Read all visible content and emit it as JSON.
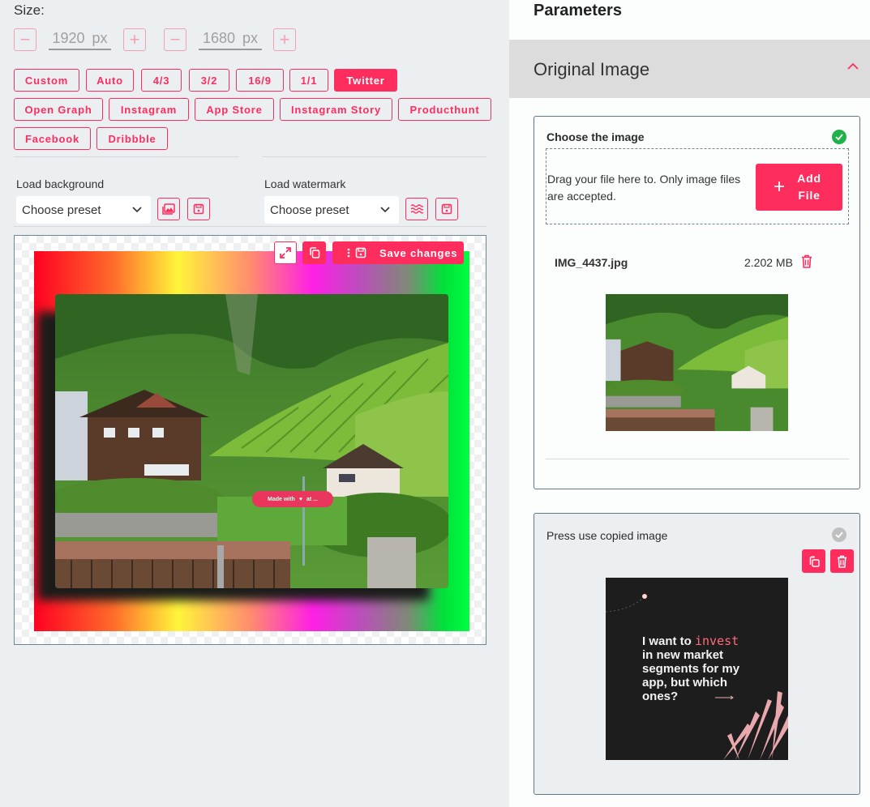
{
  "editor": {
    "size_label": "Size:",
    "width": {
      "value": "1920",
      "unit": "px",
      "decrement": "−",
      "increment": "+"
    },
    "height": {
      "value": "1680",
      "unit": "px",
      "decrement": "−",
      "increment": "+"
    },
    "presets": [
      {
        "label": "Custom",
        "active": false
      },
      {
        "label": "Auto",
        "active": false
      },
      {
        "label": "4/3",
        "active": false
      },
      {
        "label": "3/2",
        "active": false
      },
      {
        "label": "16/9",
        "active": false
      },
      {
        "label": "1/1",
        "active": false
      },
      {
        "label": "Twitter",
        "active": true
      },
      {
        "label": "Open Graph",
        "active": false
      },
      {
        "label": "Instagram",
        "active": false
      },
      {
        "label": "App Store",
        "active": false
      },
      {
        "label": "Instagram Story",
        "active": false
      },
      {
        "label": "Producthunt",
        "active": false
      },
      {
        "label": "Facebook",
        "active": false
      },
      {
        "label": "Dribbble",
        "active": false
      }
    ],
    "background": {
      "label": "Load background",
      "selected": "Choose preset",
      "icons": [
        "image-icon",
        "save-icon"
      ]
    },
    "watermark": {
      "label": "Load watermark",
      "selected": "Choose preset",
      "icons": [
        "waves-icon",
        "save-icon"
      ]
    },
    "canvas": {
      "toolbar": {
        "save_label": "Save changes"
      },
      "watermark_text": [
        "Made with",
        "♥",
        "at ..."
      ],
      "gradient_colors": [
        "#ff0022",
        "#ff6a2a",
        "#fff53a",
        "#ff8a70",
        "#ff1fe6",
        "#c04ac0",
        "#7e8a76",
        "#00e03a",
        "#00ff40"
      ]
    }
  },
  "parameters": {
    "title": "Parameters",
    "section": {
      "title": "Original Image",
      "expanded": true
    },
    "choose_image": {
      "title": "Choose the image",
      "status": "done",
      "dropzone_hint": "Drag your file here to. Only image files are accepted.",
      "add_file_label": "Add File",
      "file": {
        "name": "IMG_4437.jpg",
        "size": "2.202 MB"
      }
    },
    "copied_image": {
      "title": "Press use copied image",
      "status": "inactive",
      "preview_text": {
        "prefix": "I want to ",
        "accent": "invest",
        "rest": [
          "in new market",
          "segments for my",
          "app, but which",
          "ones?"
        ]
      }
    }
  },
  "colors": {
    "accent": "#ff2d5e",
    "success": "#1fb14a",
    "muted_check": "#c0c0c0"
  }
}
